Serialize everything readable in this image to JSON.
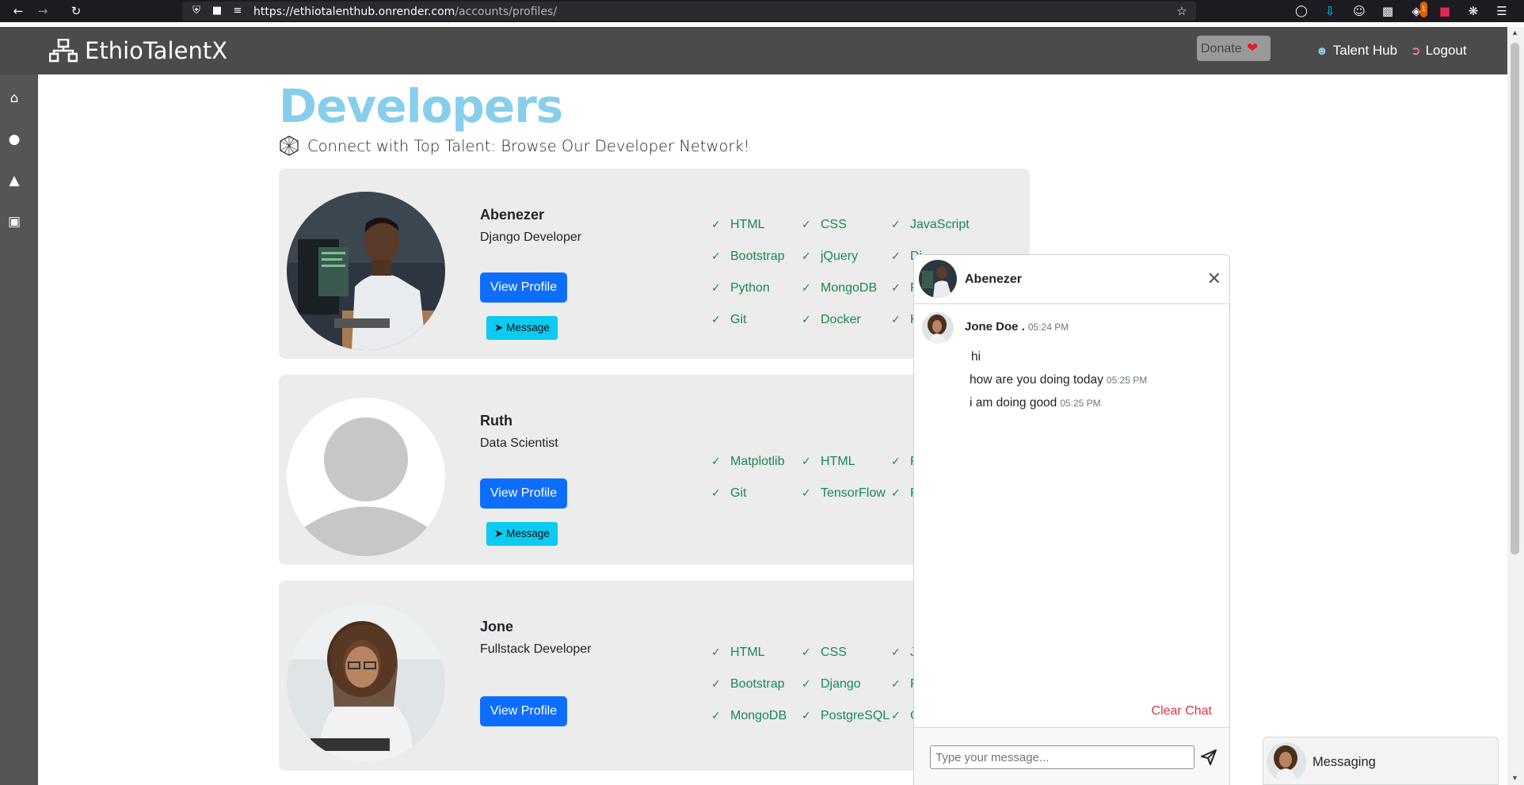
{
  "browser": {
    "url_host": "https://ethiotalenthub.onrender.com",
    "url_path": "/accounts/profiles/",
    "download_badge": "1"
  },
  "navbar": {
    "brand": "EthioTalentX",
    "donate_label": "Donate",
    "talent_hub_label": "Talent Hub",
    "logout_label": "Logout"
  },
  "page": {
    "heading": "Developers",
    "subheading": "Connect with Top Talent: Browse Our Developer Network!"
  },
  "buttons": {
    "view_profile": "View Profile",
    "message": "Message"
  },
  "developers": [
    {
      "name": "Abenezer",
      "role": "Django Developer",
      "skills": [
        [
          "HTML",
          "CSS",
          "JavaScript"
        ],
        [
          "Bootstrap",
          "jQuery",
          "Dj"
        ],
        [
          "Python",
          "MongoDB",
          "F"
        ],
        [
          "Git",
          "Docker",
          "K"
        ]
      ]
    },
    {
      "name": "Ruth",
      "role": "Data Scientist",
      "skills": [
        [
          "Matplotlib",
          "HTML",
          "F"
        ],
        [
          "Git",
          "TensorFlow",
          "F"
        ]
      ]
    },
    {
      "name": "Jone",
      "role": "Fullstack Developer",
      "skills": [
        [
          "HTML",
          "CSS",
          "J"
        ],
        [
          "Bootstrap",
          "Django",
          "F"
        ],
        [
          "MongoDB",
          "PostgreSQL",
          "C"
        ]
      ]
    }
  ],
  "chat": {
    "title": "Abenezer",
    "sender": "Jone Doe .",
    "sender_time": "05:24 PM",
    "messages": [
      {
        "text": "hi",
        "time": ""
      },
      {
        "text": "how are you doing today",
        "time": "05:25 PM"
      },
      {
        "text": "i am doing good",
        "time": "05:25 PM"
      }
    ],
    "clear_label": "Clear Chat",
    "input_placeholder": "Type your message..."
  },
  "dock": {
    "label": "Messaging"
  }
}
